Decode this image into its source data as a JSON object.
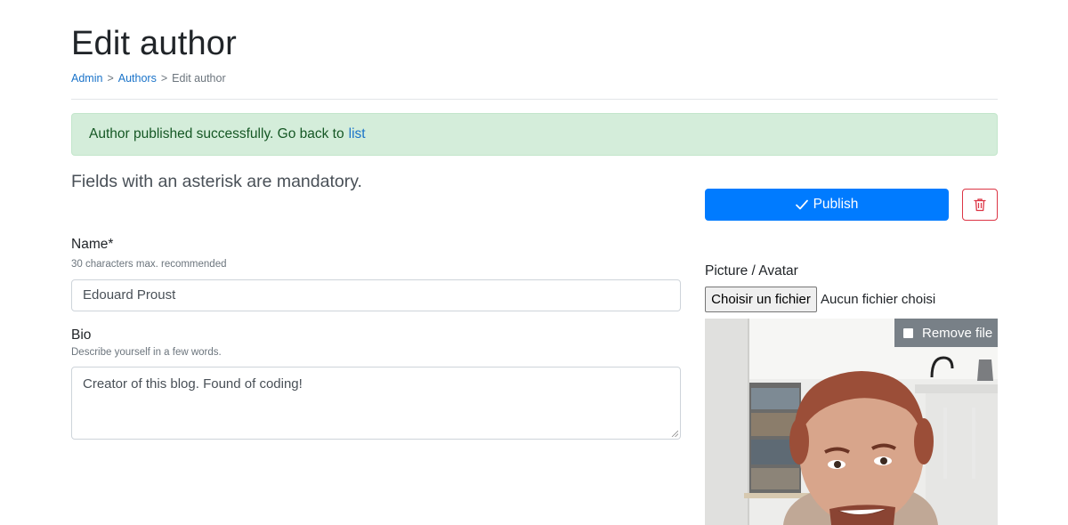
{
  "header": {
    "title": "Edit author",
    "breadcrumb": [
      {
        "label": "Admin",
        "link": true
      },
      {
        "label": ">",
        "link": false
      },
      {
        "label": "Authors",
        "link": true
      },
      {
        "label": ">",
        "link": false
      },
      {
        "label": "Edit author",
        "link": false
      }
    ]
  },
  "alert": {
    "message": "Author published successfully. Go back to",
    "link_label": "list",
    "background": "#d4edda",
    "text_color": "#155724"
  },
  "form": {
    "mandatory_note": "Fields with an asterisk are mandatory.",
    "name": {
      "label": "Name*",
      "help": "30 characters max. recommended",
      "value": "Edouard Proust"
    },
    "bio": {
      "label": "Bio",
      "help": "Describe yourself in a few words.",
      "value": "Creator of this blog. Found of coding!"
    }
  },
  "actions": {
    "publish_label": "Publish",
    "publish_icon": "check-icon",
    "publish_color": "#007bff",
    "delete_icon": "trash-icon",
    "delete_color": "#dc3545"
  },
  "picture": {
    "label": "Picture / Avatar",
    "file_button_label": "Choisir un fichier",
    "file_status": "Aucun fichier choisi",
    "remove_label": "Remove file"
  }
}
